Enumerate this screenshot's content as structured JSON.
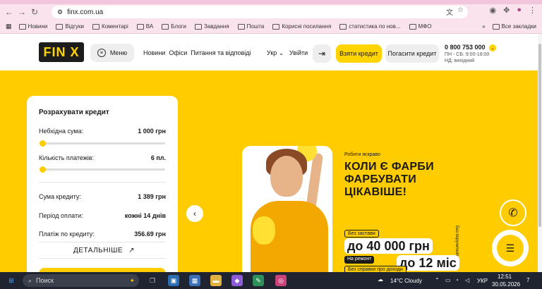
{
  "browser": {
    "url": "finx.com.ua",
    "bookmarks": [
      "Новини",
      "Відгуки",
      "Коментарі",
      "ВА",
      "Блоги",
      "Завдання",
      "Пошта",
      "Корисні посилання",
      "статистика по нов...",
      "МФО"
    ],
    "all_bookmarks": "Все закладки"
  },
  "header": {
    "logo": "FIN X",
    "menu": "Меню",
    "nav": [
      "Новини",
      "Офіси",
      "Питання та відповіді"
    ],
    "lang": "Укр ⌄",
    "login": "Увійти",
    "take_loan": "Взяти кредит",
    "repay_loan": "Погасити кредит",
    "phone": "0 800 753 000",
    "hours_1": "ПН - СБ: 9:00-18:00",
    "hours_2": "НД: вихідний"
  },
  "calculator": {
    "title": "Розрахувати кредит",
    "amount_label": "Небхідна сума:",
    "amount_value": "1 000 грн",
    "payments_label": "Кількість платежів:",
    "payments_value": "6 пл.",
    "credit_sum_label": "Сума кредиту:",
    "credit_sum_value": "1 389 грн",
    "period_label": "Період оплати:",
    "period_value": "кожні 14 днів",
    "payment_label": "Платіж по кредиту:",
    "payment_value": "356.69 грн",
    "details": "ДЕТАЛЬНІШЕ"
  },
  "banner": {
    "tagline": "Робити яскраво",
    "headline_1": "КОЛИ Є ФАРБИ",
    "headline_2": "ФАРБУВАТИ",
    "headline_3": "ЦІКАВІШЕ!",
    "chip_no_fees": "Без застави",
    "amount_big": "до 40 000 грн",
    "chip_repair": "На ремонт",
    "term_big": "до 12 міс",
    "chip_no_certs": "Без справки про доходи",
    "vertical": "Без поручителів"
  },
  "taskbar": {
    "search": "Поиск",
    "weather": "14°C  Cloudy",
    "lang": "УКР",
    "time": "12:51",
    "date": "30.05.2026",
    "notif": "7"
  }
}
